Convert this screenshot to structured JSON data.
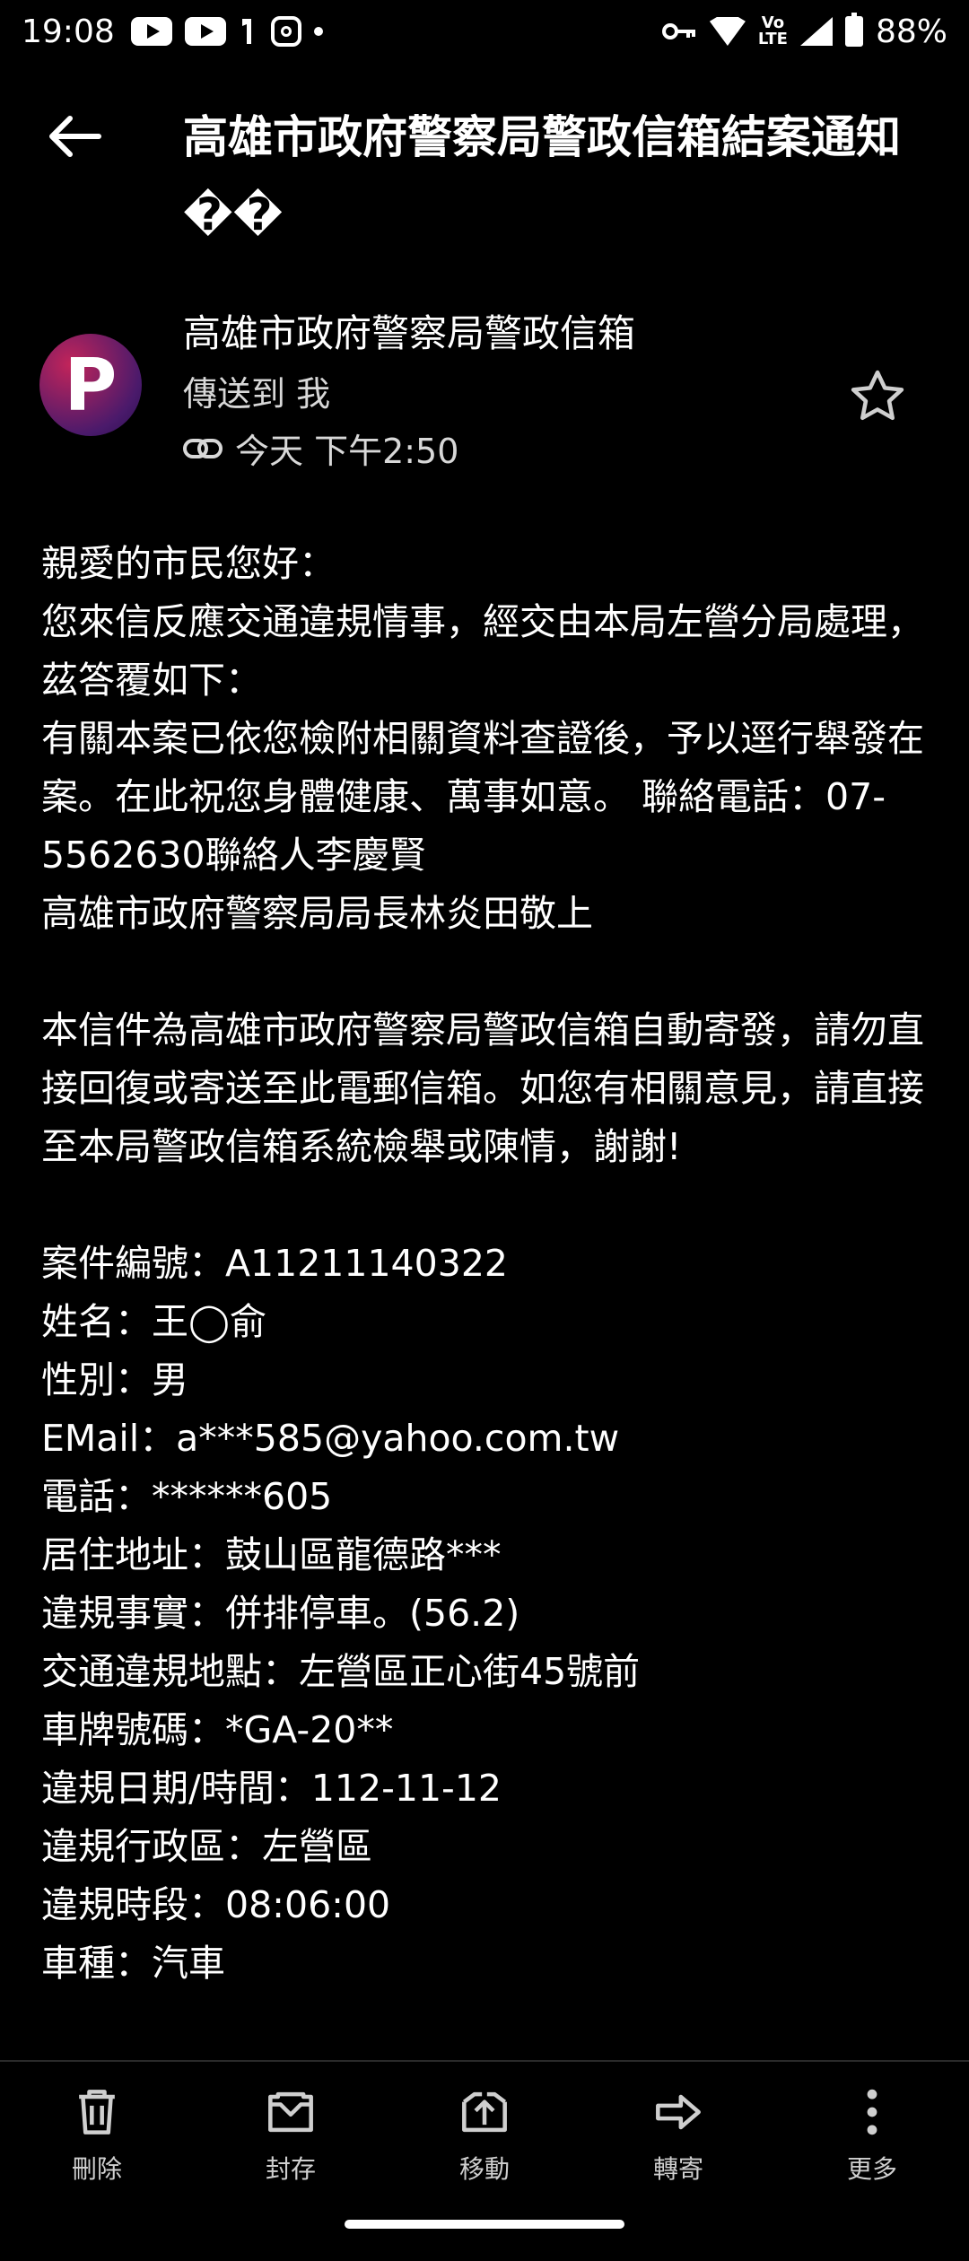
{
  "status_bar": {
    "time": "19:08",
    "network": "LTE",
    "battery": "88%",
    "icons": [
      "youtube-icon",
      "youtube-icon",
      "notification-icon",
      "instagram-icon",
      "dot-icon",
      "key-icon",
      "wifi-icon",
      "volte-icon",
      "signal-icon",
      "battery-icon"
    ]
  },
  "email": {
    "subject": "高雄市政府警察局警政信箱結案通知\n��",
    "sender_name": "高雄市政府警察局警政信箱",
    "avatar_letter": "P",
    "recipient": "傳送到 我",
    "date": "今天 下午2:50",
    "body_lines": [
      "親愛的市民您好：",
      "您來信反應交通違規情事，經交由本局左營分局處理，茲答覆如下：",
      "有關本案已依您檢附相關資料查證後，予以逕行舉發在案。在此祝您身體健康、萬事如意。 聯絡電話：07-5562630聯絡人李慶賢",
      "高雄市政府警察局局長林炎田敬上",
      "",
      "本信件為高雄市政府警察局警政信箱自動寄發，請勿直接回復或寄送至此電郵信箱。如您有相關意見，請直接至本局警政信箱系統檢舉或陳情，謝謝!",
      "",
      "案件編號：A11211140322",
      "姓名：王◯俞",
      "性別：男",
      "EMail：a***585@yahoo.com.tw",
      "電話：******605",
      "居住地址：鼓山區龍德路***",
      "違規事實：併排停車。(56.2)",
      "交通違規地點：左營區正心街45號前",
      "車牌號碼：*GA-20**",
      "違規日期/時間：112-11-12",
      "違規行政區：左營區",
      "違規時段：08:06:00",
      "車種：汽車"
    ]
  },
  "bottom_bar": {
    "delete": "刪除",
    "archive": "封存",
    "move": "移動",
    "forward": "轉寄",
    "more": "更多"
  }
}
